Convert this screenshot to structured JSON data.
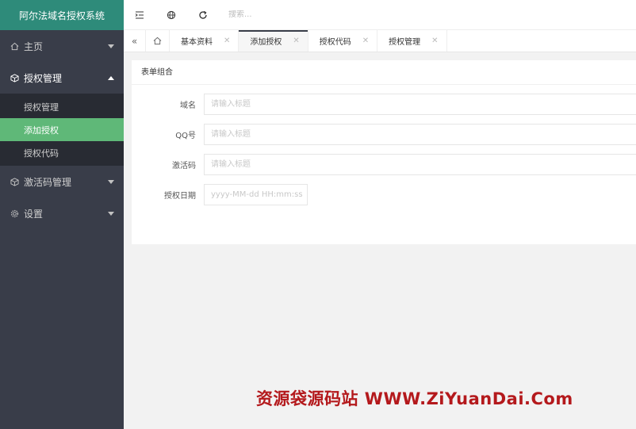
{
  "app": {
    "title": "阿尔法域名授权系统"
  },
  "sidebar": {
    "items": [
      {
        "label": "主页",
        "icon": "home-icon"
      },
      {
        "label": "授权管理",
        "icon": "box-icon",
        "open": true,
        "children": [
          {
            "label": "授权管理"
          },
          {
            "label": "添加授权",
            "active": true
          },
          {
            "label": "授权代码"
          }
        ]
      },
      {
        "label": "激活码管理",
        "icon": "box-icon"
      },
      {
        "label": "设置",
        "icon": "gear-icon"
      }
    ]
  },
  "topbar": {
    "search_placeholder": "搜索..."
  },
  "tabs": [
    {
      "label": "基本资料"
    },
    {
      "label": "添加授权",
      "active": true
    },
    {
      "label": "授权代码"
    },
    {
      "label": "授权管理"
    }
  ],
  "form": {
    "title": "表单组合",
    "fields": [
      {
        "label": "域名",
        "placeholder": "请输入标题"
      },
      {
        "label": "QQ号",
        "placeholder": "请输入标题"
      },
      {
        "label": "激活码",
        "placeholder": "请输入标题"
      },
      {
        "label": "授权日期",
        "placeholder": "yyyy-MM-dd HH:mm:ss"
      }
    ]
  },
  "watermark": "资源袋源码站 WWW.ZiYuanDai.Com",
  "colors": {
    "sidebar": "#393d49",
    "logo": "#2e8b7a",
    "active": "#5fb878",
    "watermark": "#b4191c"
  }
}
